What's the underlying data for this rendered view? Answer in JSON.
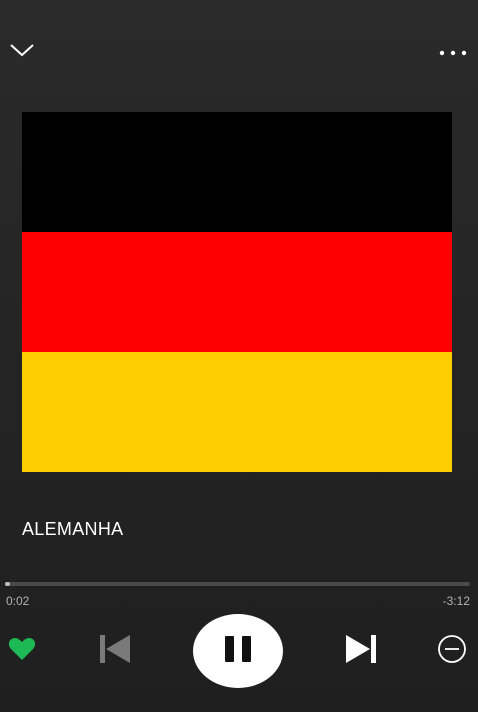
{
  "header": {
    "collapse_icon": "chevron-down-icon",
    "more_icon": "more-horizontal-icon"
  },
  "artwork": {
    "stripes": [
      "#000000",
      "#ff0000",
      "#ffce00"
    ]
  },
  "track": {
    "title": "ALEMANHA"
  },
  "progress": {
    "elapsed": "0:02",
    "remaining": "-3:12",
    "fraction": 0.01
  },
  "controls": {
    "like_icon": "heart-icon",
    "like_color": "#1db954",
    "previous_icon": "skip-back-icon",
    "play_state_icon": "pause-icon",
    "next_icon": "skip-forward-icon",
    "remove_icon": "minus-circle-icon"
  },
  "colors": {
    "background": "#222222",
    "accent": "#1db954"
  }
}
